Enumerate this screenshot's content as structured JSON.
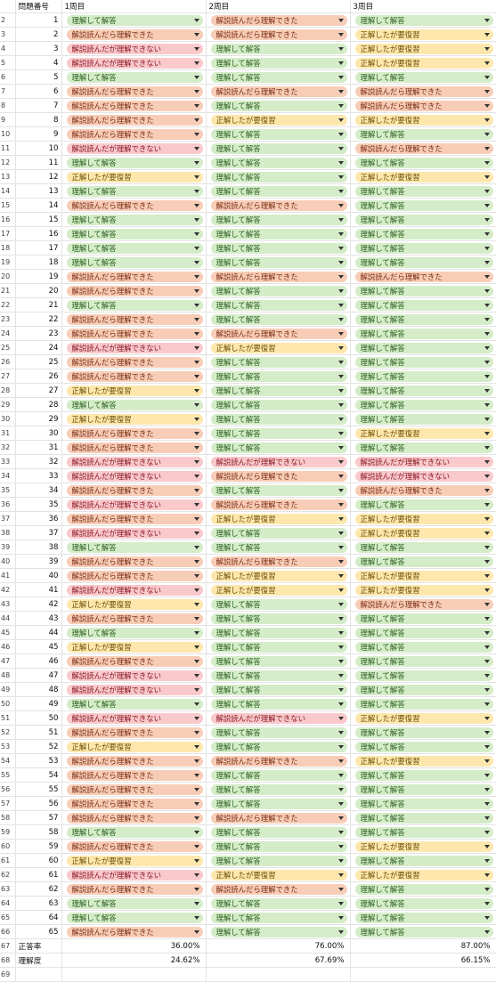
{
  "header": {
    "row_label": "",
    "col_label": "問題番号",
    "rounds": [
      "1周目",
      "2周目",
      "3周目"
    ]
  },
  "status_labels": {
    "ok": "理解して解答",
    "rev": "正解したが要復習",
    "read": "解説読んだら理解できた",
    "ng": "解説読んだが理解できない"
  },
  "status_colors": {
    "ok": "#d4ecc8",
    "rev": "#fde7ad",
    "read": "#f8cdb7",
    "ng": "#f9c9cc"
  },
  "dropdown_icon": "caret-down-icon",
  "rows": [
    {
      "rh": "2",
      "n": "1",
      "s": [
        "ok",
        "read",
        "ok"
      ]
    },
    {
      "rh": "3",
      "n": "2",
      "s": [
        "read",
        "read",
        "rev"
      ]
    },
    {
      "rh": "4",
      "n": "3",
      "s": [
        "ng",
        "ok",
        "rev"
      ]
    },
    {
      "rh": "5",
      "n": "4",
      "s": [
        "ng",
        "ok",
        "rev"
      ]
    },
    {
      "rh": "6",
      "n": "5",
      "s": [
        "ok",
        "ok",
        "ok"
      ]
    },
    {
      "rh": "7",
      "n": "6",
      "s": [
        "read",
        "read",
        "read"
      ]
    },
    {
      "rh": "8",
      "n": "7",
      "s": [
        "read",
        "ok",
        "read"
      ]
    },
    {
      "rh": "9",
      "n": "8",
      "s": [
        "read",
        "rev",
        "rev"
      ]
    },
    {
      "rh": "10",
      "n": "9",
      "s": [
        "read",
        "ok",
        "ok"
      ]
    },
    {
      "rh": "11",
      "n": "10",
      "s": [
        "ng",
        "ok",
        "read"
      ]
    },
    {
      "rh": "12",
      "n": "11",
      "s": [
        "ok",
        "ok",
        "ok"
      ]
    },
    {
      "rh": "13",
      "n": "12",
      "s": [
        "rev",
        "ok",
        "rev"
      ]
    },
    {
      "rh": "14",
      "n": "13",
      "s": [
        "ok",
        "ok",
        "ok"
      ]
    },
    {
      "rh": "15",
      "n": "14",
      "s": [
        "read",
        "read",
        "ok"
      ]
    },
    {
      "rh": "16",
      "n": "15",
      "s": [
        "ok",
        "ok",
        "ok"
      ]
    },
    {
      "rh": "17",
      "n": "16",
      "s": [
        "ok",
        "ok",
        "ok"
      ]
    },
    {
      "rh": "18",
      "n": "17",
      "s": [
        "ok",
        "ok",
        "ok"
      ]
    },
    {
      "rh": "19",
      "n": "18",
      "s": [
        "ok",
        "ok",
        "ok"
      ]
    },
    {
      "rh": "20",
      "n": "19",
      "s": [
        "read",
        "read",
        "read"
      ]
    },
    {
      "rh": "21",
      "n": "20",
      "s": [
        "read",
        "ok",
        "ok"
      ]
    },
    {
      "rh": "22",
      "n": "21",
      "s": [
        "ok",
        "ok",
        "ok"
      ]
    },
    {
      "rh": "23",
      "n": "22",
      "s": [
        "read",
        "ok",
        "ok"
      ]
    },
    {
      "rh": "24",
      "n": "23",
      "s": [
        "read",
        "read",
        "ok"
      ]
    },
    {
      "rh": "25",
      "n": "24",
      "s": [
        "ng",
        "rev",
        "ok"
      ]
    },
    {
      "rh": "26",
      "n": "25",
      "s": [
        "read",
        "ok",
        "ok"
      ]
    },
    {
      "rh": "27",
      "n": "26",
      "s": [
        "read",
        "ok",
        "ok"
      ]
    },
    {
      "rh": "28",
      "n": "27",
      "s": [
        "rev",
        "ok",
        "ok"
      ]
    },
    {
      "rh": "29",
      "n": "28",
      "s": [
        "ok",
        "ok",
        "ok"
      ]
    },
    {
      "rh": "30",
      "n": "29",
      "s": [
        "rev",
        "ok",
        "ok"
      ]
    },
    {
      "rh": "31",
      "n": "30",
      "s": [
        "read",
        "ok",
        "rev"
      ]
    },
    {
      "rh": "32",
      "n": "31",
      "s": [
        "read",
        "ok",
        "ok"
      ]
    },
    {
      "rh": "33",
      "n": "32",
      "s": [
        "ng",
        "ng",
        "ng"
      ]
    },
    {
      "rh": "34",
      "n": "33",
      "s": [
        "ng",
        "read",
        "ng"
      ]
    },
    {
      "rh": "35",
      "n": "34",
      "s": [
        "read",
        "ok",
        "read"
      ]
    },
    {
      "rh": "36",
      "n": "35",
      "s": [
        "ng",
        "read",
        "ok"
      ]
    },
    {
      "rh": "37",
      "n": "36",
      "s": [
        "read",
        "rev",
        "rev"
      ]
    },
    {
      "rh": "38",
      "n": "37",
      "s": [
        "ng",
        "ok",
        "rev"
      ]
    },
    {
      "rh": "39",
      "n": "38",
      "s": [
        "ok",
        "ok",
        "ok"
      ]
    },
    {
      "rh": "40",
      "n": "39",
      "s": [
        "read",
        "read",
        "ok"
      ]
    },
    {
      "rh": "41",
      "n": "40",
      "s": [
        "read",
        "rev",
        "rev"
      ]
    },
    {
      "rh": "42",
      "n": "41",
      "s": [
        "ng",
        "rev",
        "rev"
      ]
    },
    {
      "rh": "43",
      "n": "42",
      "s": [
        "rev",
        "ok",
        "read"
      ]
    },
    {
      "rh": "44",
      "n": "43",
      "s": [
        "read",
        "ok",
        "ok"
      ]
    },
    {
      "rh": "45",
      "n": "44",
      "s": [
        "ok",
        "ok",
        "ok"
      ]
    },
    {
      "rh": "46",
      "n": "45",
      "s": [
        "rev",
        "ok",
        "ok"
      ]
    },
    {
      "rh": "47",
      "n": "46",
      "s": [
        "read",
        "ok",
        "ok"
      ]
    },
    {
      "rh": "48",
      "n": "47",
      "s": [
        "ng",
        "ok",
        "ok"
      ]
    },
    {
      "rh": "49",
      "n": "48",
      "s": [
        "ng",
        "ok",
        "ok"
      ]
    },
    {
      "rh": "50",
      "n": "49",
      "s": [
        "ok",
        "ok",
        "ok"
      ]
    },
    {
      "rh": "51",
      "n": "50",
      "s": [
        "ng",
        "ng",
        "rev"
      ]
    },
    {
      "rh": "52",
      "n": "51",
      "s": [
        "read",
        "ok",
        "ok"
      ]
    },
    {
      "rh": "53",
      "n": "52",
      "s": [
        "rev",
        "ok",
        "ok"
      ]
    },
    {
      "rh": "54",
      "n": "53",
      "s": [
        "read",
        "read",
        "rev"
      ]
    },
    {
      "rh": "55",
      "n": "54",
      "s": [
        "read",
        "ok",
        "ok"
      ]
    },
    {
      "rh": "56",
      "n": "55",
      "s": [
        "read",
        "ok",
        "ok"
      ]
    },
    {
      "rh": "57",
      "n": "56",
      "s": [
        "read",
        "ok",
        "ok"
      ]
    },
    {
      "rh": "58",
      "n": "57",
      "s": [
        "read",
        "read",
        "ok"
      ]
    },
    {
      "rh": "59",
      "n": "58",
      "s": [
        "ok",
        "ok",
        "ok"
      ]
    },
    {
      "rh": "60",
      "n": "59",
      "s": [
        "read",
        "ok",
        "rev"
      ]
    },
    {
      "rh": "61",
      "n": "60",
      "s": [
        "rev",
        "ok",
        "ok"
      ]
    },
    {
      "rh": "62",
      "n": "61",
      "s": [
        "ng",
        "rev",
        "rev"
      ]
    },
    {
      "rh": "63",
      "n": "62",
      "s": [
        "read",
        "read",
        "ok"
      ]
    },
    {
      "rh": "64",
      "n": "63",
      "s": [
        "ok",
        "ok",
        "ok"
      ]
    },
    {
      "rh": "65",
      "n": "64",
      "s": [
        "ok",
        "ok",
        "ok"
      ]
    },
    {
      "rh": "66",
      "n": "65",
      "s": [
        "read",
        "ok",
        "ok"
      ]
    }
  ],
  "footer": [
    {
      "rh": "67",
      "label": "正答率",
      "values": [
        "36.00%",
        "76.00%",
        "87.00%"
      ]
    },
    {
      "rh": "68",
      "label": "理解度",
      "values": [
        "24.62%",
        "67.69%",
        "66.15%"
      ]
    }
  ],
  "last_row_header": "69"
}
